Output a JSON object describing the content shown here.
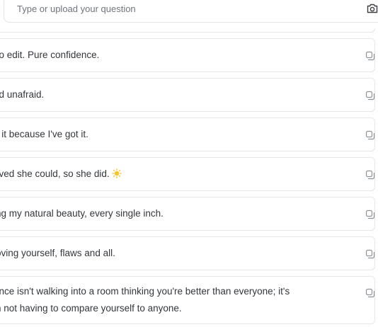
{
  "search": {
    "placeholder": "Type or upload your question",
    "camera_icon": "camera-icon"
  },
  "captions": [
    {
      "text": "no edit. Pure confidence.",
      "copy_icon": "copy-icon"
    },
    {
      "text": "nd unafraid.",
      "copy_icon": "copy-icon"
    },
    {
      "text": "g it because I've got it.",
      "copy_icon": "copy-icon"
    },
    {
      "text": "eved she could, so she did.",
      "emoji": "sun-emoji",
      "copy_icon": "copy-icon"
    },
    {
      "text": "ing my natural beauty, every single inch.",
      "copy_icon": "copy-icon"
    },
    {
      "text": "loving yourself, flaws and all.",
      "copy_icon": "copy-icon"
    },
    {
      "line1": "ance isn't walking into a room thinking you're better than everyone; it's",
      "line2": "in not having to compare yourself to anyone.",
      "copy_icon": "copy-icon"
    }
  ]
}
